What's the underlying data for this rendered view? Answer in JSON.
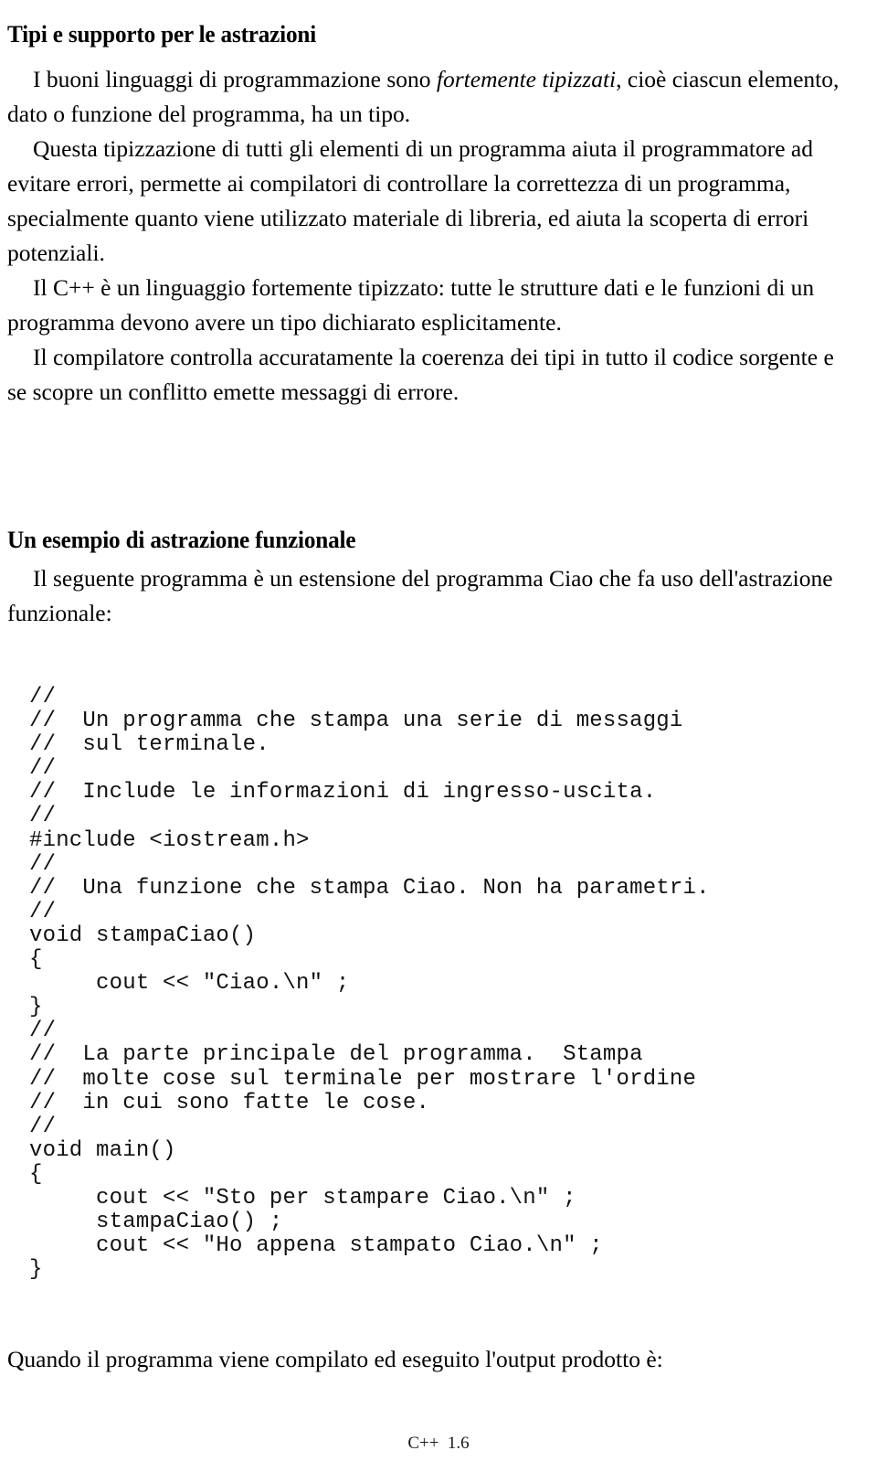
{
  "document": {
    "sections": {
      "heading_1": "Tipi e supporto per le astrazioni",
      "heading_2": "Un esempio di astrazione funzionale"
    },
    "intro": {
      "p1_before_italic": "I buoni linguaggi di programmazione sono ",
      "p1_italic": "fortemente tipizzati",
      "p1_after_italic": ", cioè ciascun elemento, dato o funzione del programma, ha un tipo.",
      "p2": "Questa tipizzazione di tutti gli elementi di un programma aiuta il programmatore ad evitare errori, permette ai compilatori di controllare la correttezza di un programma, specialmente quanto viene utilizzato materiale di libreria, ed aiuta la scoperta di errori potenziali.",
      "p3": "Il C++ è un linguaggio fortemente tipizzato: tutte le strutture dati e le funzioni di un programma devono avere un tipo dichiarato esplicitamente.",
      "p4": "Il compilatore controlla accuratamente la coerenza dei tipi in tutto il codice sorgente e se scopre un conflitto emette messaggi di errore."
    },
    "example": {
      "intro": "Il seguente programma è un estensione del programma Ciao che fa uso dell'astrazione funzionale:",
      "closing": "Quando il programma viene compilato ed eseguito l'output prodotto è:"
    },
    "code_listing": {
      "language": "C++",
      "lines": [
        "//",
        "//  Un programma che stampa una serie di messaggi",
        "//  sul terminale.",
        "//",
        "//  Include le informazioni di ingresso-uscita.",
        "//",
        "#include <iostream.h>",
        "//",
        "//  Una funzione che stampa Ciao. Non ha parametri.",
        "//",
        "void stampaCiao()",
        "{",
        "     cout << \"Ciao.\\n\" ;",
        "}",
        "//",
        "//  La parte principale del programma.  Stampa",
        "//  molte cose sul terminale per mostrare l'ordine",
        "//  in cui sono fatte le cose.",
        "//",
        "void main()",
        "{",
        "     cout << \"Sto per stampare Ciao.\\n\" ;",
        "     stampaCiao() ;",
        "     cout << \"Ho appena stampato Ciao.\\n\" ;",
        "}"
      ]
    },
    "footer": {
      "page_label": "C++  1.6"
    },
    "colors": {
      "page_background": "#ffffff",
      "text": "#000000",
      "code_text": "#111111",
      "footer_text": "#1a1a1a"
    }
  }
}
